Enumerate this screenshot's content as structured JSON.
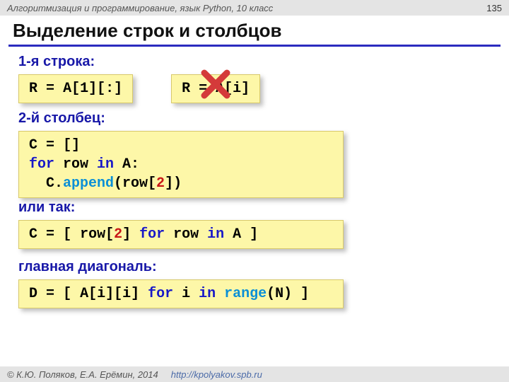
{
  "header": {
    "course": "Алгоритмизация и программирование, язык Python, 10 класс",
    "page": "135"
  },
  "title": "Выделение строк и столбцов",
  "s1": {
    "label": "1-я строка:",
    "code1_a": "R",
    "code1_eq": "=",
    "code1_b": "A[1][:]",
    "bad_a": "R",
    "bad_eq": "=",
    "bad_b": "A[i]"
  },
  "s2": {
    "label": "2-й столбец:",
    "l1_a": "C",
    "l1_eq": "=",
    "l1_b": "[]",
    "l2_for": "for",
    "l2_row": " row ",
    "l2_in": "in",
    "l2_a": " A:",
    "l3_pad": "  C.",
    "l3_fn": "append",
    "l3_open": "(row[",
    "l3_num": "2",
    "l3_close": "])"
  },
  "s3": {
    "label": "или так:",
    "a": "C",
    "eq": "=",
    "open": "[ row[",
    "num": "2",
    "mid": "] ",
    "for": "for",
    "row": " row ",
    "in": "in",
    "end": " A ]"
  },
  "s4": {
    "label": "главная диагональ:",
    "a": "D",
    "eq": "=",
    "open": "[ A[i][i] ",
    "for": "for",
    "i": " i ",
    "in": "in",
    "sp": " ",
    "fn": "range",
    "end": "(N) ]"
  },
  "footer": {
    "copyright": "© К.Ю. Поляков, Е.А. Ерёмин, 2014",
    "link": "http://kpolyakov.spb.ru"
  }
}
